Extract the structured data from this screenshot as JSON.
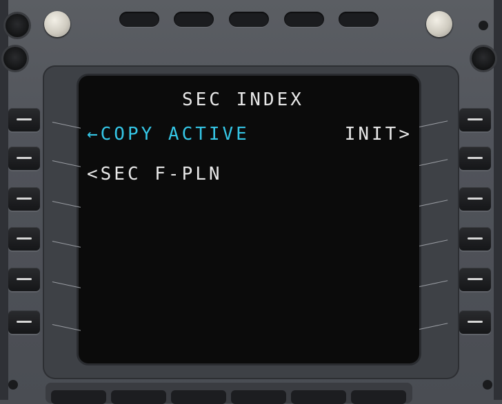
{
  "mcdu": {
    "page_title": "SEC INDEX",
    "line1_left": "←COPY ACTIVE",
    "line1_right": "INIT>",
    "line2_left": "<SEC F-PLN",
    "colors": {
      "text_white": "#e8e8e8",
      "text_cyan": "#35c6e6",
      "screen_bg": "#0b0b0b",
      "bezel": "#4a4d52"
    }
  },
  "icons": {
    "left_lsk": "dash-icon",
    "right_lsk": "dash-icon"
  }
}
